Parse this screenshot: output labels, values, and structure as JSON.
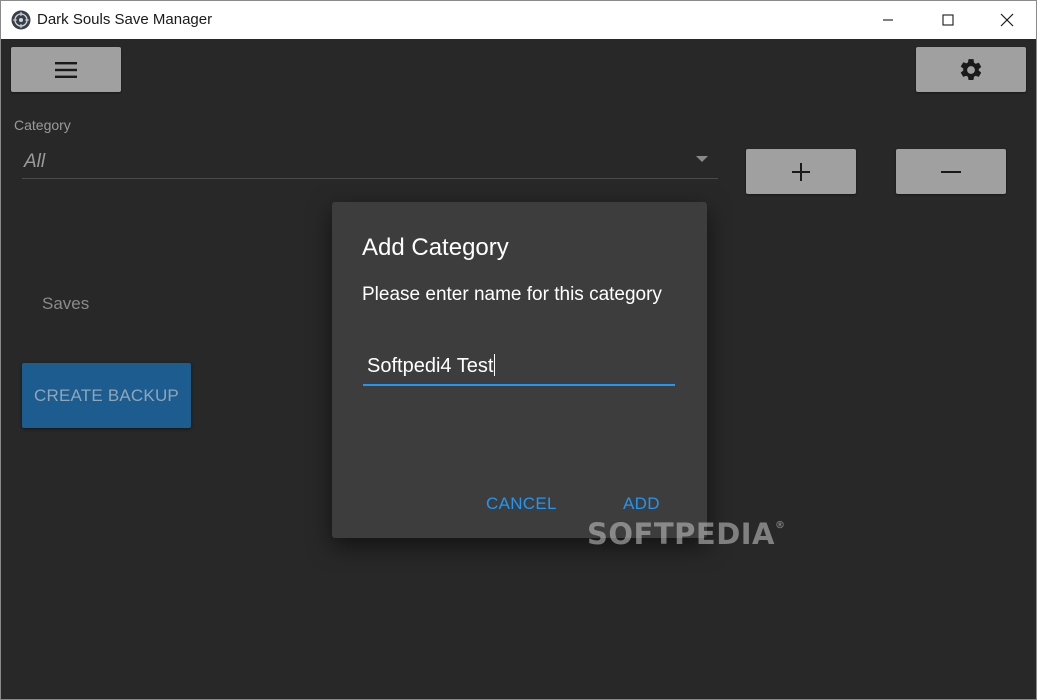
{
  "window": {
    "title": "Dark Souls Save Manager"
  },
  "toolbar": {
    "menu_icon": "hamburger-menu-icon",
    "settings_icon": "gear-icon"
  },
  "category": {
    "label": "Category",
    "selected": "All",
    "add_icon": "plus-icon",
    "remove_icon": "minus-icon"
  },
  "saves": {
    "label": "Saves",
    "create_backup_label": "CREATE BACKUP"
  },
  "dialog": {
    "title": "Add Category",
    "message": "Please enter name for this category",
    "input_value": "Softpedi4 Test",
    "cancel_label": "CANCEL",
    "add_label": "ADD"
  },
  "watermark": {
    "text": "SOFTPEDIA",
    "mark": "®"
  },
  "colors": {
    "background": "#282828",
    "dialog": "#3d3d3d",
    "accent": "#2196f3",
    "primary_button": "#1d5c8f",
    "tool_button": "#a0a0a0"
  }
}
